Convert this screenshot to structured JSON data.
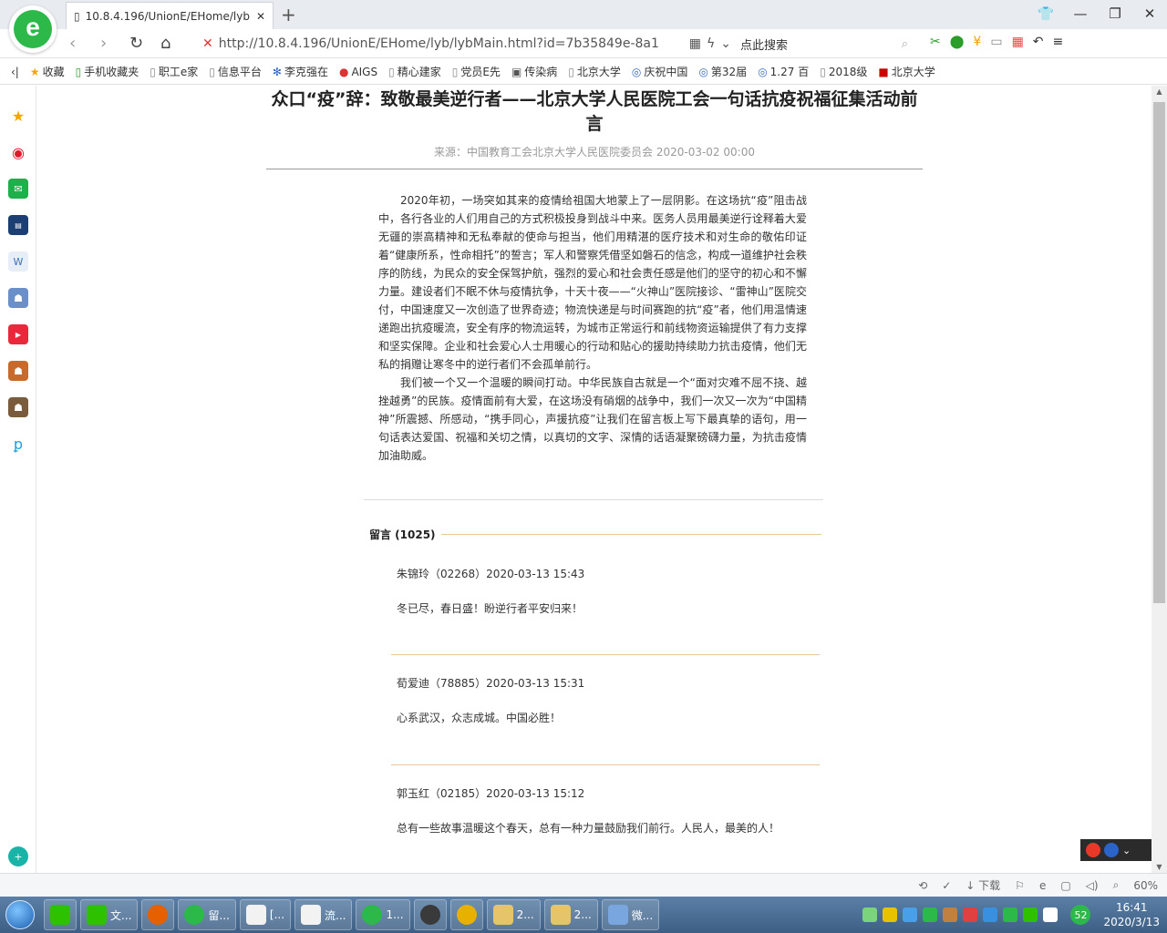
{
  "browser": {
    "tab_title": "10.8.4.196/UnionE/EHome/lyb",
    "url": "http://10.8.4.196/UnionE/EHome/lyb/lybMain.html?id=7b35849e-8a1",
    "search_placeholder": "点此搜索",
    "new_tab": "+",
    "zoom": "60%",
    "download_label": "下载"
  },
  "bookmarks": [
    {
      "label": "收藏",
      "icon": "star-icon"
    },
    {
      "label": "手机收藏夹",
      "icon": "phone-icon"
    },
    {
      "label": "职工e家",
      "icon": "page-icon"
    },
    {
      "label": "信息平台",
      "icon": "page-icon"
    },
    {
      "label": "李克强在",
      "icon": "paw-icon"
    },
    {
      "label": "AIGS",
      "icon": "pin-icon"
    },
    {
      "label": "精心建家",
      "icon": "page-icon"
    },
    {
      "label": "党员E先",
      "icon": "page-icon"
    },
    {
      "label": "传染病",
      "icon": "image-icon"
    },
    {
      "label": "北京大学",
      "icon": "page-icon"
    },
    {
      "label": "庆祝中国",
      "icon": "globe-icon"
    },
    {
      "label": "第32届",
      "icon": "globe-icon"
    },
    {
      "label": "1.27 百",
      "icon": "globe-icon"
    },
    {
      "label": "2018级",
      "icon": "page-icon"
    },
    {
      "label": "北京大学",
      "icon": "logo-icon"
    }
  ],
  "article": {
    "title": "众口“疫”辞：致敬最美逆行者——北京大学人民医院工会一句话抗疫祝福征集活动前言",
    "source": "来源：中国教育工会北京大学人民医院委员会  2020-03-02 00:00",
    "paragraphs": [
      "2020年初，一场突如其来的疫情给祖国大地蒙上了一层阴影。在这场抗“疫”阻击战中，各行各业的人们用自己的方式积极投身到战斗中来。医务人员用最美逆行诠释着大爱无疆的崇高精神和无私奉献的使命与担当，他们用精湛的医疗技术和对生命的敬佑印证着“健康所系，性命相托”的誓言；军人和警察凭借坚如磐石的信念，构成一道维护社会秩序的防线，为民众的安全保驾护航，强烈的爱心和社会责任感是他们的坚守的初心和不懈力量。建设者们不眠不休与疫情抗争，十天十夜——“火神山”医院接诊、“雷神山”医院交付，中国速度又一次创造了世界奇迹；物流快递是与时间赛跑的抗“疫”者，他们用温情速递跑出抗疫暖流，安全有序的物流运转，为城市正常运行和前线物资运输提供了有力支撑和坚实保障。企业和社会爱心人士用暖心的行动和贴心的援助持续助力抗击疫情，他们无私的捐赠让寒冬中的逆行者们不会孤单前行。",
      "我们被一个又一个温暖的瞬间打动。中华民族自古就是一个“面对灾难不屈不挠、越挫越勇”的民族。疫情面前有大爱，在这场没有硝烟的战争中，我们一次又一次为“中国精神”所震撼、所感动，“携手同心，声援抗疫”让我们在留言板上写下最真挚的语句，用一句话表达爱国、祝福和关切之情，以真切的文字、深情的话语凝聚磅礴力量，为抗击疫情加油助威。"
    ]
  },
  "comments": {
    "header": "留言 (1025)",
    "items": [
      {
        "meta": "朱锦玲（02268）2020-03-13 15:43",
        "text": "冬已尽，春日盛！盼逆行者平安归来！"
      },
      {
        "meta": "荀爱迪（78885）2020-03-13 15:31",
        "text": "心系武汉，众志成城。中国必胜！"
      },
      {
        "meta": "郭玉红（02185）2020-03-13 15:12",
        "text": "总有一些故事温暖这个春天，总有一种力量鼓励我们前行。人民人，最美的人！"
      }
    ]
  },
  "taskbar": {
    "items": [
      {
        "label": "",
        "icon": "wechat-icon"
      },
      {
        "label": "文...",
        "icon": "wechat-icon"
      },
      {
        "label": "",
        "icon": "firefox-icon"
      },
      {
        "label": "留...",
        "icon": "browser-e-icon"
      },
      {
        "label": "[...",
        "icon": "document-icon"
      },
      {
        "label": "流...",
        "icon": "document-icon"
      },
      {
        "label": "1...",
        "icon": "browser-e-icon"
      },
      {
        "label": "",
        "icon": "media-icon"
      },
      {
        "label": "",
        "icon": "chrome-icon"
      },
      {
        "label": "2...",
        "icon": "folder-icon"
      },
      {
        "label": "2...",
        "icon": "folder-icon"
      },
      {
        "label": "微...",
        "icon": "weather-icon"
      }
    ],
    "time": "16:41",
    "date": "2020/3/13",
    "badge": "52"
  }
}
